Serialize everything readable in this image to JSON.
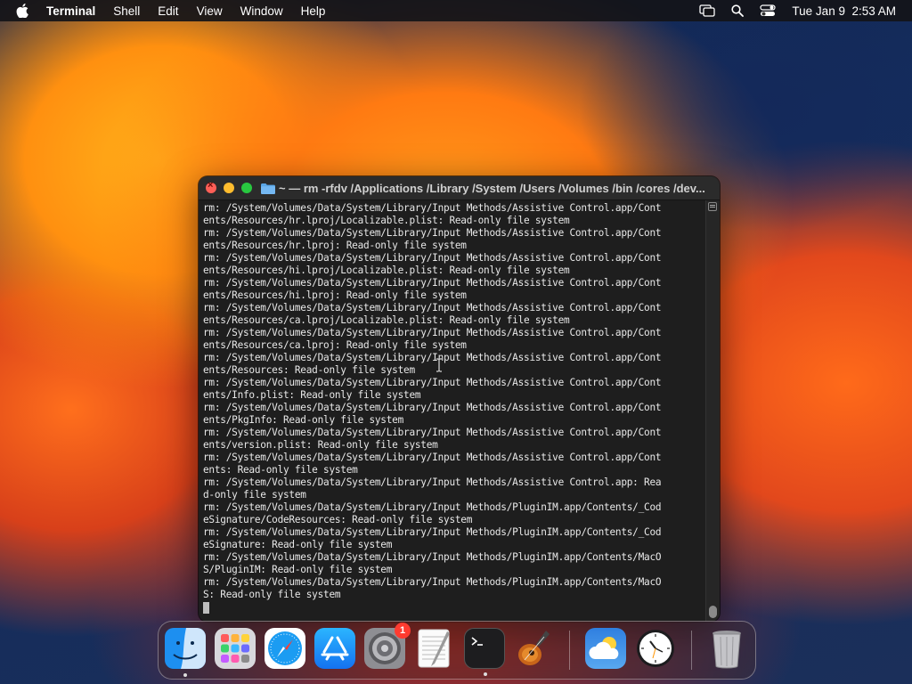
{
  "menubar": {
    "app_name": "Terminal",
    "items": [
      "Shell",
      "Edit",
      "View",
      "Window",
      "Help"
    ],
    "datetime": "Tue Jan 9  2:53 AM"
  },
  "window": {
    "title": "~ — rm -rfdv /Applications /Library /System /Users /Volumes /bin /cores /dev...",
    "lines": [
      "rm: /System/Volumes/Data/System/Library/Input Methods/Assistive Control.app/Cont",
      "ents/Resources/hr.lproj/Localizable.plist: Read-only file system",
      "rm: /System/Volumes/Data/System/Library/Input Methods/Assistive Control.app/Cont",
      "ents/Resources/hr.lproj: Read-only file system",
      "rm: /System/Volumes/Data/System/Library/Input Methods/Assistive Control.app/Cont",
      "ents/Resources/hi.lproj/Localizable.plist: Read-only file system",
      "rm: /System/Volumes/Data/System/Library/Input Methods/Assistive Control.app/Cont",
      "ents/Resources/hi.lproj: Read-only file system",
      "rm: /System/Volumes/Data/System/Library/Input Methods/Assistive Control.app/Cont",
      "ents/Resources/ca.lproj/Localizable.plist: Read-only file system",
      "rm: /System/Volumes/Data/System/Library/Input Methods/Assistive Control.app/Cont",
      "ents/Resources/ca.lproj: Read-only file system",
      "rm: /System/Volumes/Data/System/Library/Input Methods/Assistive Control.app/Cont",
      "ents/Resources: Read-only file system",
      "rm: /System/Volumes/Data/System/Library/Input Methods/Assistive Control.app/Cont",
      "ents/Info.plist: Read-only file system",
      "rm: /System/Volumes/Data/System/Library/Input Methods/Assistive Control.app/Cont",
      "ents/PkgInfo: Read-only file system",
      "rm: /System/Volumes/Data/System/Library/Input Methods/Assistive Control.app/Cont",
      "ents/version.plist: Read-only file system",
      "rm: /System/Volumes/Data/System/Library/Input Methods/Assistive Control.app/Cont",
      "ents: Read-only file system",
      "rm: /System/Volumes/Data/System/Library/Input Methods/Assistive Control.app: Rea",
      "d-only file system",
      "rm: /System/Volumes/Data/System/Library/Input Methods/PluginIM.app/Contents/_Cod",
      "eSignature/CodeResources: Read-only file system",
      "rm: /System/Volumes/Data/System/Library/Input Methods/PluginIM.app/Contents/_Cod",
      "eSignature: Read-only file system",
      "rm: /System/Volumes/Data/System/Library/Input Methods/PluginIM.app/Contents/MacO",
      "S/PluginIM: Read-only file system",
      "rm: /System/Volumes/Data/System/Library/Input Methods/PluginIM.app/Contents/MacO",
      "S: Read-only file system"
    ]
  },
  "dock": {
    "items": [
      "finder-icon",
      "launchpad-icon",
      "safari-icon",
      "app-store-icon",
      "system-settings-icon",
      "textedit-icon",
      "terminal-icon",
      "garageband-icon",
      "weather-icon",
      "clock-icon",
      "trash-icon"
    ],
    "system_settings_badge": "1"
  }
}
